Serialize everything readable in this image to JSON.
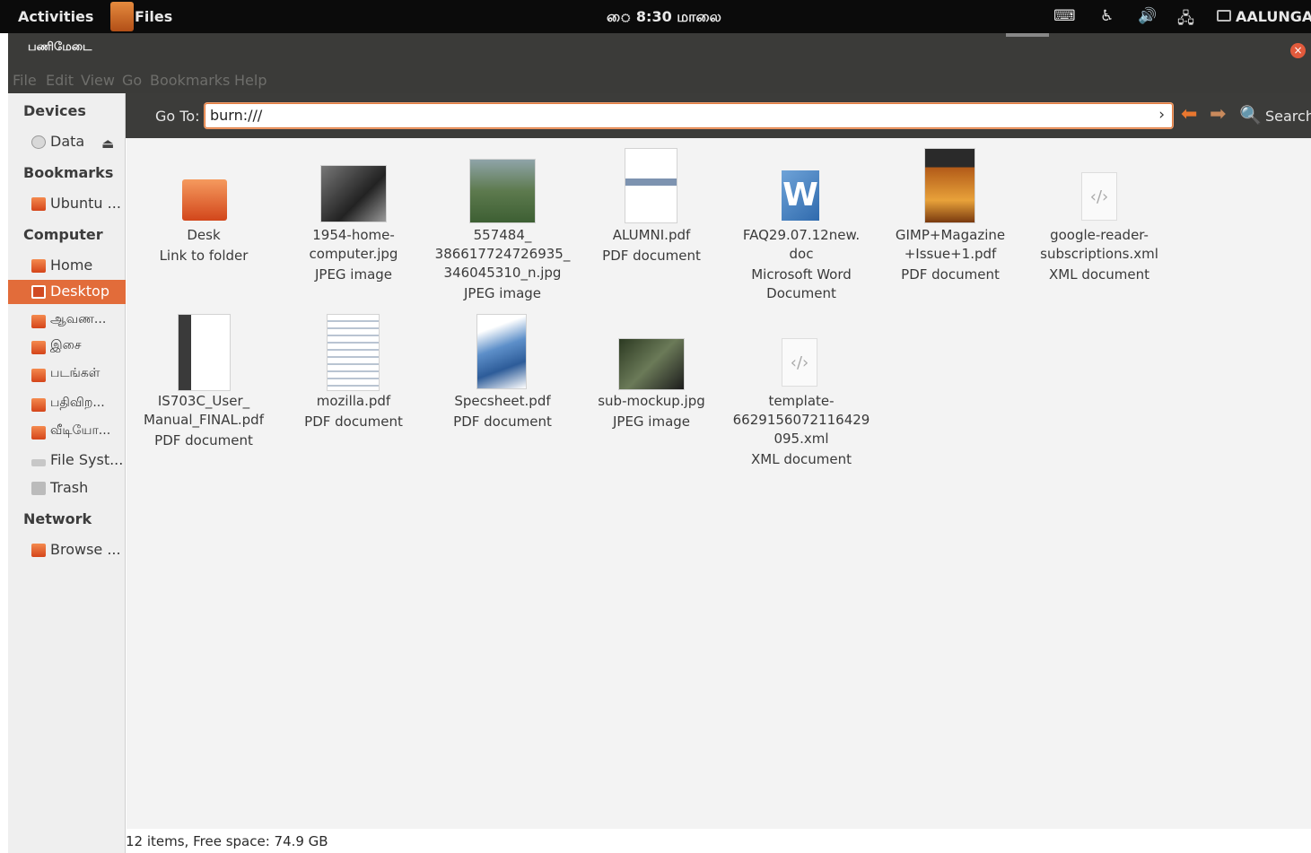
{
  "top_panel": {
    "activities": "Activities",
    "app_name": "Files",
    "clock": "ை 8:30 மாலை",
    "user": "AALUNGA",
    "indicators": [
      "keyboard-icon",
      "accessibility-icon",
      "volume-icon",
      "network-icon"
    ]
  },
  "window": {
    "title": "பணிமேடை",
    "close": "×"
  },
  "menu": [
    "File",
    "Edit",
    "View",
    "Go",
    "Bookmarks",
    "Help"
  ],
  "toolbar": {
    "goto_label": "Go To:",
    "location_value": "burn:///",
    "search_label": "Search"
  },
  "sidebar": {
    "devices_header": "Devices",
    "bookmarks_header": "Bookmarks",
    "computer_header": "Computer",
    "network_header": "Network",
    "items": [
      {
        "label": "Data",
        "icon": "drive-icon"
      },
      {
        "label": "Ubuntu ...",
        "icon": "folder-icon"
      },
      {
        "label": "Home",
        "icon": "home-folder-icon"
      },
      {
        "label": "Desktop",
        "icon": "desktop-icon"
      },
      {
        "label": "ஆவண...",
        "icon": "documents-folder-icon"
      },
      {
        "label": "இசை",
        "icon": "music-folder-icon"
      },
      {
        "label": "படங்கள்",
        "icon": "pictures-folder-icon"
      },
      {
        "label": "பதிவிற...",
        "icon": "downloads-folder-icon"
      },
      {
        "label": "வீடியோ...",
        "icon": "videos-folder-icon"
      },
      {
        "label": "File Syst...",
        "icon": "filesystem-icon"
      },
      {
        "label": "Trash",
        "icon": "trash-icon"
      },
      {
        "label": "Browse ...",
        "icon": "network-folder-icon"
      }
    ]
  },
  "files": [
    {
      "name": "Desk",
      "type": "Link to folder"
    },
    {
      "name": "1954-home-\ncomputer.jpg",
      "type": "JPEG image"
    },
    {
      "name": "557484_\n386617724726935_\n346045310_n.jpg",
      "type": "JPEG image"
    },
    {
      "name": "ALUMNI.pdf",
      "type": "PDF document"
    },
    {
      "name": "FAQ29.07.12new.\ndoc",
      "type": "Microsoft Word\nDocument"
    },
    {
      "name": "GIMP+Magazine\n+Issue+1.pdf",
      "type": "PDF document"
    },
    {
      "name": "google-reader-\nsubscriptions.xml",
      "type": "XML document"
    },
    {
      "name": "IS703C_User_\nManual_FINAL.pdf",
      "type": "PDF document"
    },
    {
      "name": "mozilla.pdf",
      "type": "PDF document"
    },
    {
      "name": "Specsheet.pdf",
      "type": "PDF document"
    },
    {
      "name": "sub-mockup.jpg",
      "type": "JPEG image"
    },
    {
      "name": "template-\n6629156072116429\n095.xml",
      "type": "XML document"
    }
  ],
  "status": "12 items, Free space: 74.9 GB"
}
